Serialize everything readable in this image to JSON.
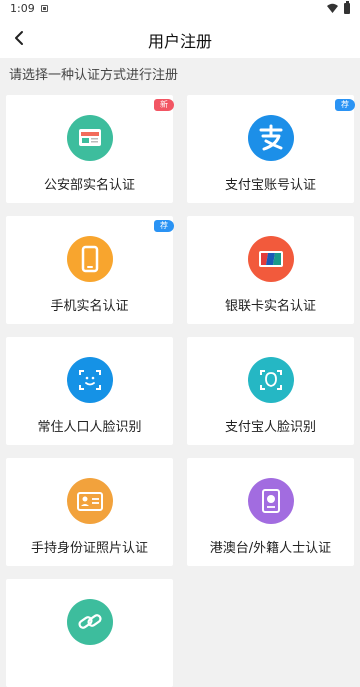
{
  "status": {
    "time": "1:09"
  },
  "header": {
    "title": "用户注册"
  },
  "hint": "请选择一种认证方式进行注册",
  "methods": [
    {
      "label": "公安部实名认证",
      "badge": "新",
      "icon": "id-card-icon",
      "color": "#3dbd9d"
    },
    {
      "label": "支付宝账号认证",
      "badge": "荐",
      "icon": "alipay-icon",
      "color": "#1c8fe8"
    },
    {
      "label": "手机实名认证",
      "badge": "荐",
      "icon": "phone-icon",
      "color": "#f8a52e"
    },
    {
      "label": "银联卡实名认证",
      "badge": "",
      "icon": "unionpay-card-icon",
      "color": "#f25a3c"
    },
    {
      "label": "常住人口人脸识别",
      "badge": "",
      "icon": "face-scan-icon",
      "color": "#1592e6"
    },
    {
      "label": "支付宝人脸识别",
      "badge": "",
      "icon": "face-outline-icon",
      "color": "#25b7c4"
    },
    {
      "label": "手持身份证照片认证",
      "badge": "",
      "icon": "id-photo-icon",
      "color": "#f2a23c"
    },
    {
      "label": "港澳台/外籍人士认证",
      "badge": "",
      "icon": "passport-icon",
      "color": "#a26ce0"
    },
    {
      "label": "",
      "badge": "",
      "icon": "link-icon",
      "color": "#3dbd9d"
    }
  ]
}
